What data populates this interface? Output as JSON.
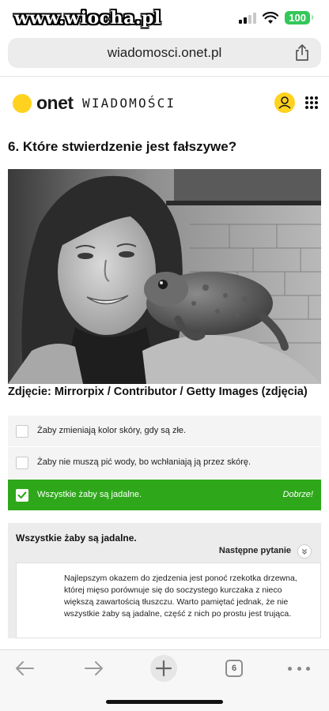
{
  "status_bar": {
    "watermark": "www.wiocha.pl",
    "battery": "100"
  },
  "address_bar": {
    "url": "wiadomosci.onet.pl"
  },
  "site": {
    "logo": "onet",
    "section": "WIADOMOŚCI"
  },
  "quiz": {
    "question": "6. Które stwierdzenie jest fałszywe?",
    "photo_caption": "Zdjęcie: Mirrorpix / Contributor / Getty Images (zdjęcia)",
    "answers": [
      {
        "label": "Żaby zmieniają kolor skóry, gdy są złe.",
        "selected": false
      },
      {
        "label": "Żaby nie muszą pić wody, bo wchłaniają ją przez skórę.",
        "selected": false
      },
      {
        "label": "Wszystkie żaby są jadalne.",
        "selected": true,
        "verdict": "Dobrze!"
      }
    ],
    "explanation": {
      "title": "Wszystkie żaby są jadalne.",
      "next_label": "Następne pytanie",
      "text": "Najlepszym okazem do zjedzenia jest ponoć rzekotka drzewna, której mięso porównuje się do soczystego kurczaka z nieco większą zawartością tłuszczu. Warto pamiętać jednak, że nie wszystkie żaby są jadalne, część z nich po prostu jest trująca."
    }
  },
  "toolbar": {
    "tab_count": "6"
  },
  "colors": {
    "correct": "#2ea81a",
    "brand": "#ffd21f",
    "battery": "#34c759"
  }
}
